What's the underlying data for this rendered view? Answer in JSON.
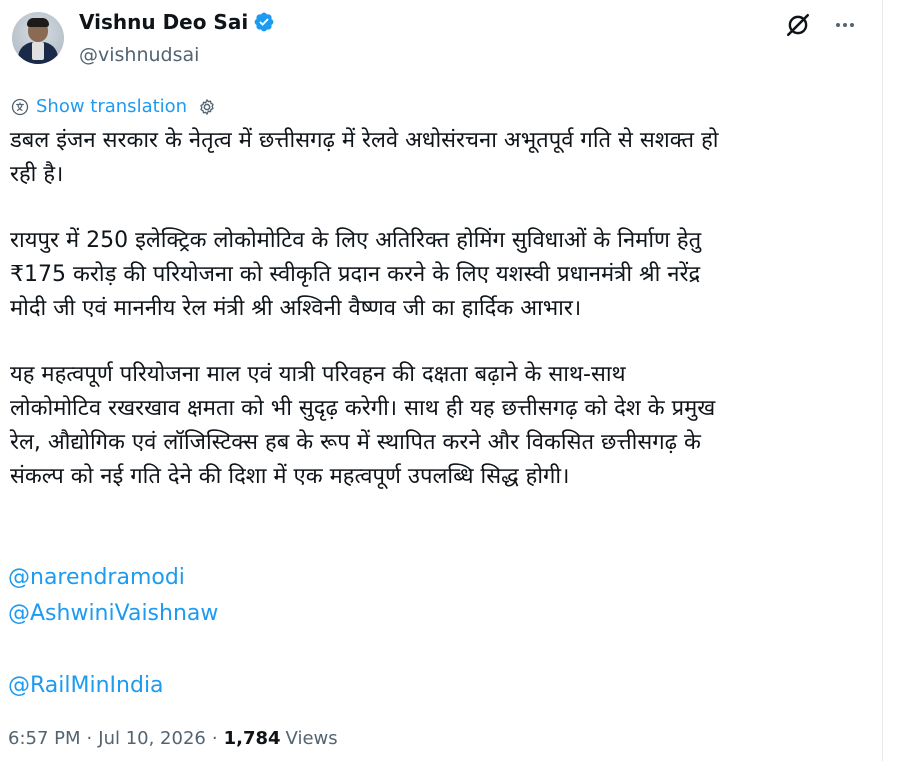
{
  "author": {
    "display_name": "Vishnu Deo Sai",
    "handle": "@vishnudsai",
    "verified": true,
    "verified_color": "#1d9bf0"
  },
  "header_actions": {
    "grok_icon": "grok-icon",
    "more_icon": "more-icon"
  },
  "translation": {
    "label": "Show translation",
    "icon": "translate-icon",
    "settings_icon": "settings-icon"
  },
  "post": {
    "lines": [
      "डबल इंजन सरकार के नेतृत्व में छत्तीसगढ़ में रेलवे अधोसंरचना अभूतपूर्व गति से सशक्त हो",
      "रही है।",
      "रायपुर में 250 इलेक्ट्रिक लोकोमोटिव के लिए अतिरिक्त होमिंग सुविधाओं के निर्माण हेतु",
      "₹175 करोड़ की परियोजना को स्वीकृति प्रदान करने के लिए यशस्वी प्रधानमंत्री श्री नरेंद्र",
      "मोदी जी एवं माननीय रेल मंत्री श्री अश्विनी वैष्णव जी का हार्दिक आभार।",
      "यह महत्वपूर्ण परियोजना माल एवं यात्री परिवहन की दक्षता बढ़ाने के साथ-साथ",
      "लोकोमोटिव रखरखाव क्षमता को भी सुदृढ़ करेगी।  साथ ही यह छत्तीसगढ़ को देश के प्रमुख",
      "रेल, औद्योगिक एवं लॉजिस्टिक्स हब के रूप में स्थापित करने और विकसित छत्तीसगढ़ के",
      "संकल्प को नई गति देने की दिशा में एक महत्वपूर्ण उपलब्धि सिद्ध होगी।"
    ],
    "mentions": [
      "@narendramodi",
      "@AshwiniVaishnaw",
      "@RailMinIndia"
    ],
    "link_color": "#1d9bf0"
  },
  "meta": {
    "time": "6:57 PM",
    "separator": "·",
    "date": "Jul 10, 2026",
    "views_count": "1,784",
    "views_label": "Views"
  }
}
